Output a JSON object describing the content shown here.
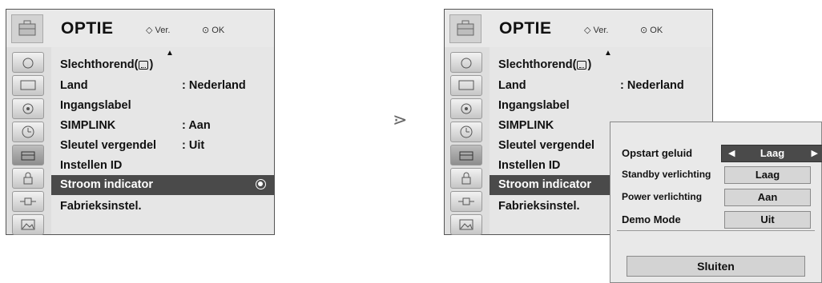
{
  "menu": {
    "title": "OPTIE",
    "hint_move": "Ver.",
    "hint_ok": "OK",
    "items": [
      {
        "label": "Slechthorend(",
        "label_suffix": ")",
        "value": ""
      },
      {
        "label": "Land",
        "value": ": Nederland"
      },
      {
        "label": "Ingangslabel",
        "value": ""
      },
      {
        "label": "SIMPLINK",
        "value": ": Aan"
      },
      {
        "label": "Sleutel vergendel",
        "value": ": Uit"
      },
      {
        "label": "Instellen ID",
        "value": ""
      },
      {
        "label": "Stroom indicator",
        "value": ""
      },
      {
        "label": "Fabrieksinstel.",
        "value": ""
      }
    ],
    "selected_item": "Stroom indicator",
    "side_icons": [
      "satellite-icon",
      "monitor-icon",
      "speaker-icon",
      "clock-icon",
      "toolbox-icon",
      "lock-icon",
      "plug-icon",
      "picture-icon"
    ]
  },
  "separator_glyph": "⋗",
  "popup": {
    "rows": [
      {
        "label": "Opstart geluid",
        "value": "Laag"
      },
      {
        "label": "Standby verlichting",
        "value": "Laag"
      },
      {
        "label": "Power verlichting",
        "value": "Aan"
      },
      {
        "label": "Demo Mode",
        "value": "Uit"
      }
    ],
    "close_label": "Sluiten"
  },
  "colors": {
    "selected_row": "#4a4a4a",
    "menu_bg": "#e6e6e6"
  }
}
